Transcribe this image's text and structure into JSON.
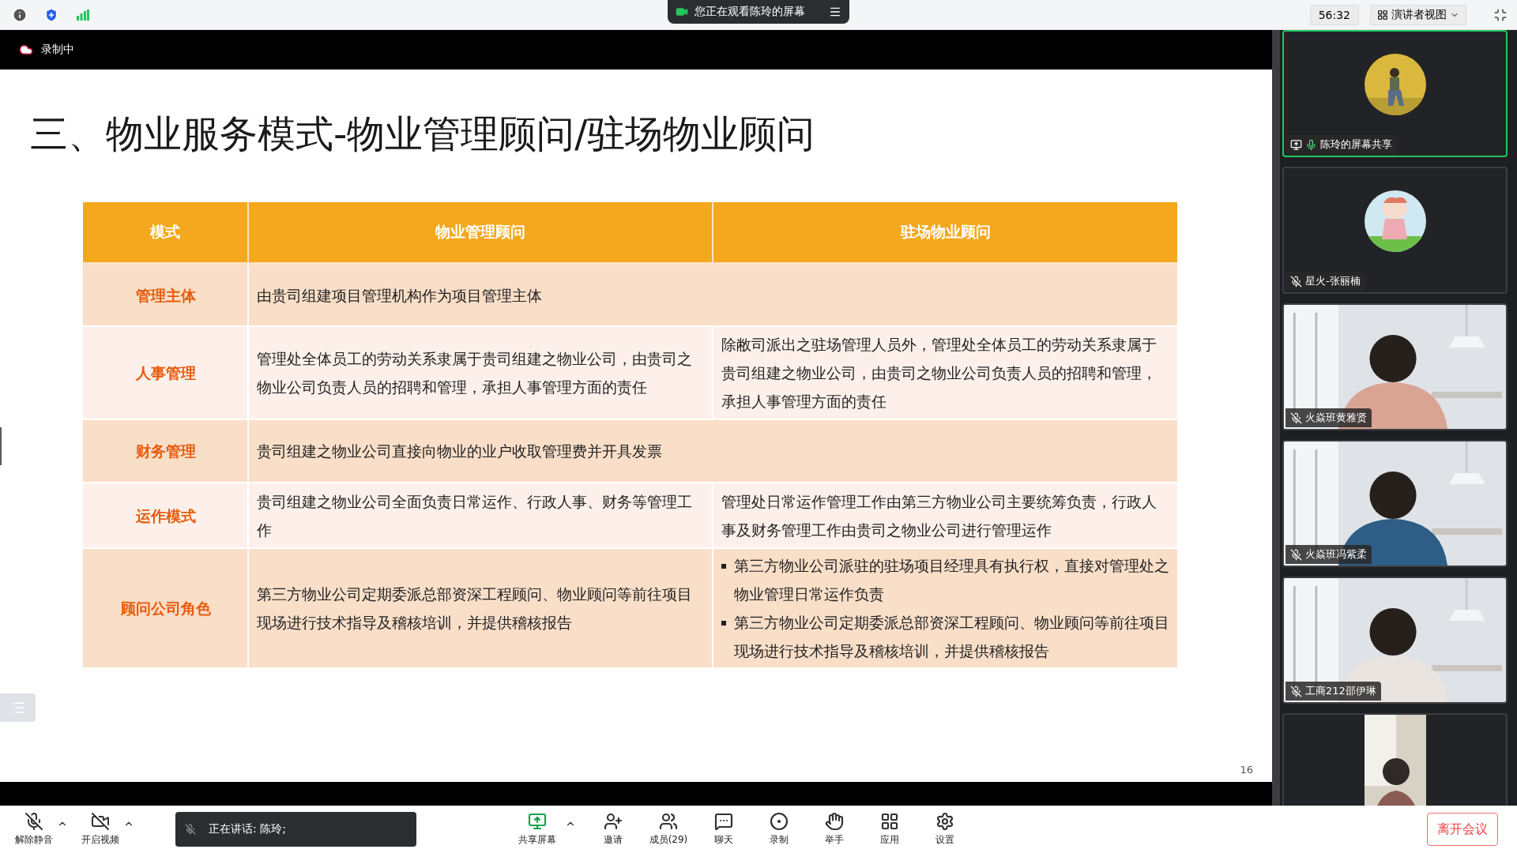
{
  "top_bar": {
    "viewing_banner": "您正在观看陈玲的屏幕",
    "timer": "56:32",
    "view_menu": "演讲者视图"
  },
  "recording": {
    "label": "录制中"
  },
  "slide": {
    "title": "三、物业服务模式-物业管理顾问/驻场物业顾问",
    "columns": [
      "模式",
      "物业管理顾问",
      "驻场物业顾问"
    ],
    "rows": [
      {
        "kind": "span",
        "cells": [
          "管理主体",
          "由贵司组建项目管理机构作为项目管理主体"
        ]
      },
      {
        "kind": "split",
        "cells": [
          "人事管理",
          "管理处全体员工的劳动关系隶属于贵司组建之物业公司，由贵司之物业公司负责人员的招聘和管理，承担人事管理方面的责任",
          "除敝司派出之驻场管理人员外，管理处全体员工的劳动关系隶属于贵司组建之物业公司，由贵司之物业公司负责人员的招聘和管理，承担人事管理方面的责任"
        ]
      },
      {
        "kind": "span",
        "cells": [
          "财务管理",
          "贵司组建之物业公司直接向物业的业户收取管理费并开具发票"
        ]
      },
      {
        "kind": "split",
        "cells": [
          "运作模式",
          "贵司组建之物业公司全面负责日常运作、行政人事、财务等管理工作",
          "管理处日常运作管理工作由第三方物业公司主要统筹负责，行政人事及财务管理工作由贵司之物业公司进行管理运作"
        ]
      },
      {
        "kind": "bullets",
        "cells": [
          "顾问公司角色",
          "第三方物业公司定期委派总部资深工程顾问、物业顾问等前往项目现场进行技术指导及稽核培训，并提供稽核报告"
        ],
        "bullets": [
          "第三方物业公司派驻的驻场项目经理具有执行权，直接对管理处之物业管理日常运作负责",
          "第三方物业公司定期委派总部资深工程顾问、物业顾问等前往项目现场进行技术指导及稽核培训，并提供稽核报告"
        ]
      }
    ],
    "page_number": "16"
  },
  "participants": [
    {
      "kind": "avatar",
      "name": "陈玲的屏幕共享",
      "muted": false,
      "sharing": true,
      "active": true
    },
    {
      "kind": "cartoon",
      "name": "星火-张丽楠",
      "muted": true,
      "sharing": false,
      "active": false
    },
    {
      "kind": "video",
      "name": "火焱班黄雅贤",
      "muted": true,
      "sharing": false,
      "active": false
    },
    {
      "kind": "video",
      "name": "火焱班冯紫柔",
      "muted": true,
      "sharing": false,
      "active": false
    },
    {
      "kind": "video",
      "name": "工商212邵伊琳",
      "muted": true,
      "sharing": false,
      "active": false
    },
    {
      "kind": "portrait",
      "active": false
    }
  ],
  "media_controls": [
    {
      "kind": "mute",
      "label": "解除静音"
    },
    {
      "kind": "video",
      "label": "开启视频"
    }
  ],
  "speaking": {
    "text": "正在讲话: 陈玲;"
  },
  "meeting_controls": [
    {
      "kind": "share",
      "label": "共享屏幕"
    },
    {
      "kind": "invite",
      "label": "邀请"
    },
    {
      "kind": "members",
      "label": "成员(29)"
    },
    {
      "kind": "chat",
      "label": "聊天"
    },
    {
      "kind": "record",
      "label": "录制"
    },
    {
      "kind": "hand",
      "label": "举手"
    },
    {
      "kind": "apps",
      "label": "应用"
    },
    {
      "kind": "settings",
      "label": "设置"
    }
  ],
  "leave_button": "离开会议"
}
